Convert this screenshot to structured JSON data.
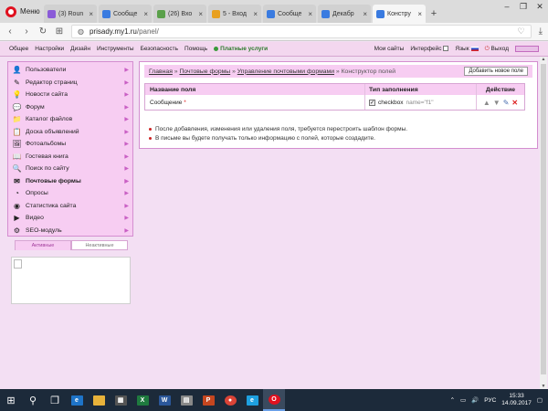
{
  "browser": {
    "menu_label": "Меню",
    "tabs": [
      {
        "title": "(3) Roun",
        "color": "#8a5bd8",
        "active": false
      },
      {
        "title": "Сообще",
        "color": "#3a7be0",
        "active": false
      },
      {
        "title": "(26) Вхо",
        "color": "#5aa04a",
        "active": false
      },
      {
        "title": "5 - Вход",
        "color": "#e8a020",
        "active": false
      },
      {
        "title": "Сообще",
        "color": "#3a7be0",
        "active": false
      },
      {
        "title": "Декабр",
        "color": "#3a7be0",
        "active": false
      },
      {
        "title": "Констру",
        "color": "#3a7be0",
        "active": true
      }
    ],
    "url_host": "prisady.my1.ru",
    "url_path": "/panel/"
  },
  "topmenu": {
    "items": [
      "Общее",
      "Настройки",
      "Дизайн",
      "Инструменты",
      "Безопасность",
      "Помощь"
    ],
    "paid": "Платные услуги",
    "my_sites": "Мои сайты",
    "interface": "Интерфейс",
    "language": "Язык",
    "logout": "Выход"
  },
  "sidebar": {
    "items": [
      {
        "label": "Пользователи",
        "icon": "user-icon",
        "glyph": "👤",
        "bold": false
      },
      {
        "label": "Редактор страниц",
        "icon": "page-editor-icon",
        "glyph": "✎",
        "bold": false
      },
      {
        "label": "Новости сайта",
        "icon": "news-icon",
        "glyph": "💡",
        "bold": false
      },
      {
        "label": "Форум",
        "icon": "forum-icon",
        "glyph": "💬",
        "bold": false
      },
      {
        "label": "Каталог файлов",
        "icon": "file-catalog-icon",
        "glyph": "📁",
        "bold": false
      },
      {
        "label": "Доска объявлений",
        "icon": "board-icon",
        "glyph": "📋",
        "bold": false
      },
      {
        "label": "Фотоальбомы",
        "icon": "photo-icon",
        "glyph": "🖼",
        "bold": false
      },
      {
        "label": "Гостевая книга",
        "icon": "guestbook-icon",
        "glyph": "📖",
        "bold": false
      },
      {
        "label": "Поиск по сайту",
        "icon": "search-icon",
        "glyph": "🔍",
        "bold": false
      },
      {
        "label": "Почтовые формы",
        "icon": "mail-form-icon",
        "glyph": "✉",
        "bold": true
      },
      {
        "label": "Опросы",
        "icon": "poll-icon",
        "glyph": "◔",
        "bold": false
      },
      {
        "label": "Статистика сайта",
        "icon": "stats-icon",
        "glyph": "◉",
        "bold": false
      },
      {
        "label": "Видео",
        "icon": "video-icon",
        "glyph": "▶",
        "bold": false
      },
      {
        "label": "SEO-модуль",
        "icon": "seo-icon",
        "glyph": "⚙",
        "bold": false
      }
    ],
    "tab_active": "Активные",
    "tab_inactive": "Неактивные"
  },
  "main": {
    "breadcrumb": {
      "home": "Главная",
      "sep": "»",
      "mail_forms": "Почтовые формы",
      "manage": "Управление почтовыми формами",
      "current": "Конструктор полей"
    },
    "add_button": "Добавить новое поле",
    "table": {
      "headers": [
        "Название поля",
        "Тип заполнения",
        "Действие"
      ],
      "rows": [
        {
          "name": "Сообщение",
          "required_mark": "*",
          "type": "checkbox",
          "code": "name=\"f1\""
        }
      ]
    },
    "notes": [
      "После добавления, изменения или удаления поля, требуется перестроить шаблон формы.",
      "В письме вы будете получать только информацию с полей, которые создадите."
    ]
  },
  "taskbar": {
    "lang": "РУС",
    "time": "15:33",
    "date": "14.09.2017"
  }
}
